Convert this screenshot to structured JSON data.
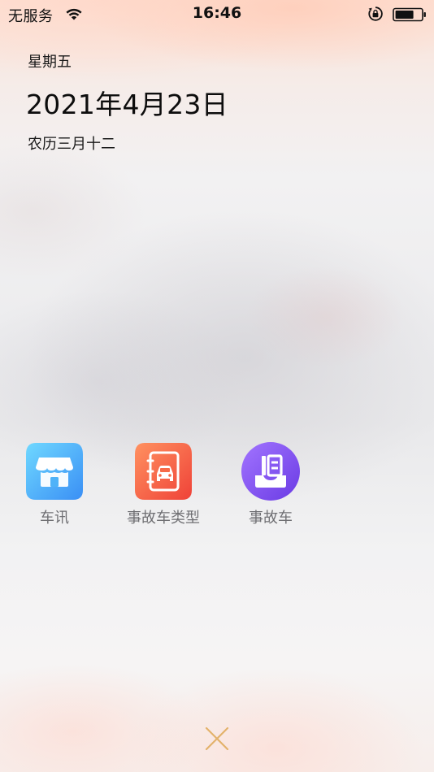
{
  "status_bar": {
    "carrier": "无服务",
    "time": "16:46",
    "icons": [
      "wifi-icon",
      "rotation-lock-icon",
      "battery-icon"
    ]
  },
  "date_block": {
    "weekday": "星期五",
    "date": "2021年4月23日",
    "lunar": "农历三月十二"
  },
  "apps": [
    {
      "label": "车讯",
      "icon": "storefront-icon",
      "color_from": "#64d2ff",
      "color_to": "#3a8ff5"
    },
    {
      "label": "事故车类型",
      "icon": "car-notebook-icon",
      "color_from": "#ff8a5c",
      "color_to": "#f0453a"
    },
    {
      "label": "事故车",
      "icon": "inbox-document-icon",
      "color_from": "#9a6bff",
      "color_to": "#6b3de6"
    }
  ],
  "close": {
    "icon": "close-icon",
    "color": "#e8b873"
  }
}
